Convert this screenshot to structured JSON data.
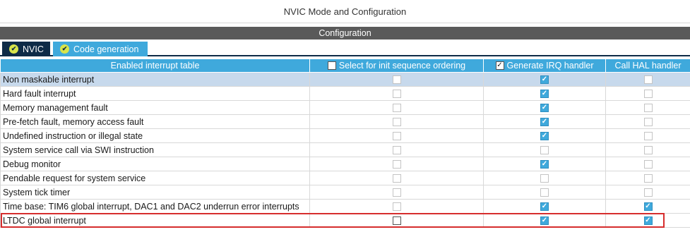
{
  "window": {
    "title": "NVIC Mode and Configuration"
  },
  "section": {
    "title": "Configuration"
  },
  "tabs": [
    {
      "label": "NVIC",
      "active": false
    },
    {
      "label": "Code generation",
      "active": true
    }
  ],
  "table": {
    "headers": {
      "name": "Enabled interrupt table",
      "init_seq": "Select for init sequence ordering",
      "irq": "Generate IRQ handler",
      "hal": "Call HAL handler"
    },
    "header_checks": {
      "init_seq": false,
      "irq": true
    },
    "rows": [
      {
        "name": "Non maskable interrupt",
        "init_seq": false,
        "irq": true,
        "hal": false,
        "selected": true
      },
      {
        "name": "Hard fault interrupt",
        "init_seq": false,
        "irq": true,
        "hal": false
      },
      {
        "name": "Memory management fault",
        "init_seq": false,
        "irq": true,
        "hal": false
      },
      {
        "name": "Pre-fetch fault, memory access fault",
        "init_seq": false,
        "irq": true,
        "hal": false
      },
      {
        "name": "Undefined instruction or illegal state",
        "init_seq": false,
        "irq": true,
        "hal": false
      },
      {
        "name": "System service call via SWI instruction",
        "init_seq": false,
        "irq": false,
        "hal": false
      },
      {
        "name": "Debug monitor",
        "init_seq": false,
        "irq": true,
        "hal": false
      },
      {
        "name": "Pendable request for system service",
        "init_seq": false,
        "irq": false,
        "hal": false
      },
      {
        "name": "System tick timer",
        "init_seq": false,
        "irq": false,
        "hal": false
      },
      {
        "name": "Time base: TIM6 global interrupt, DAC1 and DAC2 underrun error interrupts",
        "init_seq": false,
        "irq": true,
        "hal": true
      },
      {
        "name": "LTDC global interrupt",
        "init_seq": false,
        "irq": true,
        "hal": true,
        "init_active": true
      }
    ]
  },
  "colors": {
    "accent": "#3fa9dc",
    "dark_tab": "#0e2b47",
    "highlight": "#d62d2d"
  },
  "icons": {
    "tab_check": "check-circle-icon",
    "checkbox": "checkbox-icon"
  }
}
